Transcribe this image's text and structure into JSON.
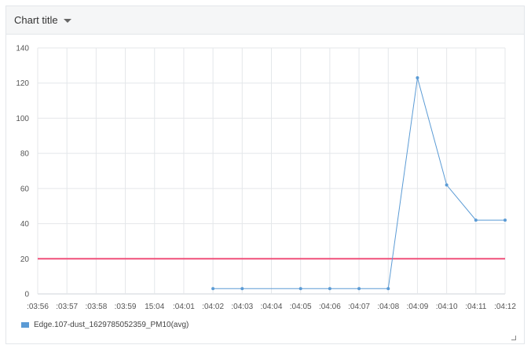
{
  "panel": {
    "title": "Chart title",
    "caret_icon": "caret-down-icon"
  },
  "chart_data": {
    "type": "line",
    "title": "",
    "xlabel": "",
    "ylabel": "",
    "x": [
      ":03:56",
      ":03:57",
      ":03:58",
      ":03:59",
      "15:04",
      ":04:01",
      ":04:02",
      ":04:03",
      ":04:04",
      ":04:05",
      ":04:06",
      ":04:07",
      ":04:08",
      ":04:09",
      ":04:10",
      ":04:11",
      ":04:12"
    ],
    "ylim": [
      0,
      140
    ],
    "yticks": [
      0,
      20,
      40,
      60,
      80,
      100,
      120,
      140
    ],
    "grid": true,
    "legend_position": "bottom-left",
    "series": [
      {
        "name": "Edge.107-dust_1629785052359_PM10(avg)",
        "color": "#5b9bd5",
        "values": [
          null,
          null,
          null,
          null,
          null,
          null,
          3,
          3,
          null,
          3,
          3,
          3,
          3,
          123,
          62,
          42,
          42
        ]
      }
    ],
    "threshold": {
      "value": 20,
      "color": "#f0507a"
    }
  }
}
